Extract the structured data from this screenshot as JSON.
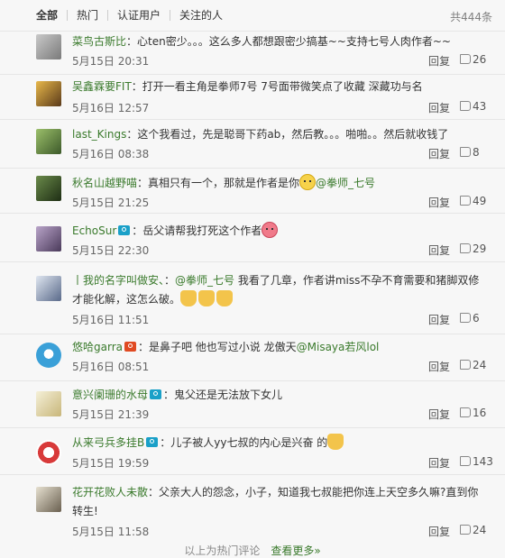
{
  "tabs": [
    "全部",
    "热门",
    "认证用户",
    "关注的人"
  ],
  "total": "共444条",
  "reply_label": "回复",
  "comments": [
    {
      "user": "菜鸟古斯比",
      "text": "：心ten密少。。。这么多人都想跟密少搞基~~支持七号人肉作者~~",
      "time": "5月15日 20:31",
      "likes": "26"
    },
    {
      "user": "吴鑫霖要FIT",
      "text": "：打开一看主角是拳师7号 7号面带微笑点了收藏 深藏功与名",
      "time": "5月16日 12:57",
      "likes": "43"
    },
    {
      "user": "last_Kings",
      "text": "：这个我看过，先是聪哥下药ab，然后教。。。啪啪。。然后就收钱了",
      "time": "5月16日 08:38",
      "likes": "8"
    },
    {
      "user": "秋名山越野喵",
      "text": "：真相只有一个，那就是作者是你",
      "at": "@拳师_七号",
      "time": "5月15日 21:25",
      "likes": "49"
    },
    {
      "user": "EchoSur",
      "text": "：岳父请帮我打死这个作者",
      "time": "5月15日 22:30",
      "likes": "29"
    },
    {
      "user": "丨我的名字叫做安、",
      "at": "@拳师_七号",
      "text": " 我看了几章，作者讲miss不孕不育需要和猪脚双修",
      "text2": "才能化解，这怎么破。",
      "time": "5月16日 11:51",
      "likes": "6"
    },
    {
      "user": "悠哈garra",
      "text": "：是鼻子吧 他也写过小说 龙傲天",
      "at": "@Misaya若风lol",
      "time": "5月16日 08:51",
      "likes": "24"
    },
    {
      "user": "意兴阑珊的水母",
      "text": "：鬼父还是无法放下女儿",
      "time": "5月15日 21:39",
      "likes": "16"
    },
    {
      "user": "从来弓兵多挂B",
      "text": "：儿子被人yy七叔的内心是兴奋 的",
      "time": "5月15日 19:59",
      "likes": "143"
    },
    {
      "user": "花开花败人未散",
      "text": "：父亲大人的怨念，小子，知道我七叔能把你连上天空多久嘛?直到你",
      "text2": "转生!",
      "time": "5月15日 11:58",
      "likes": "24"
    }
  ],
  "footer": {
    "note": "以上为热门评论",
    "more": "查看更多»"
  },
  "colors": {
    "username": "#3a7a2c",
    "verified": "#1aa0c8"
  }
}
